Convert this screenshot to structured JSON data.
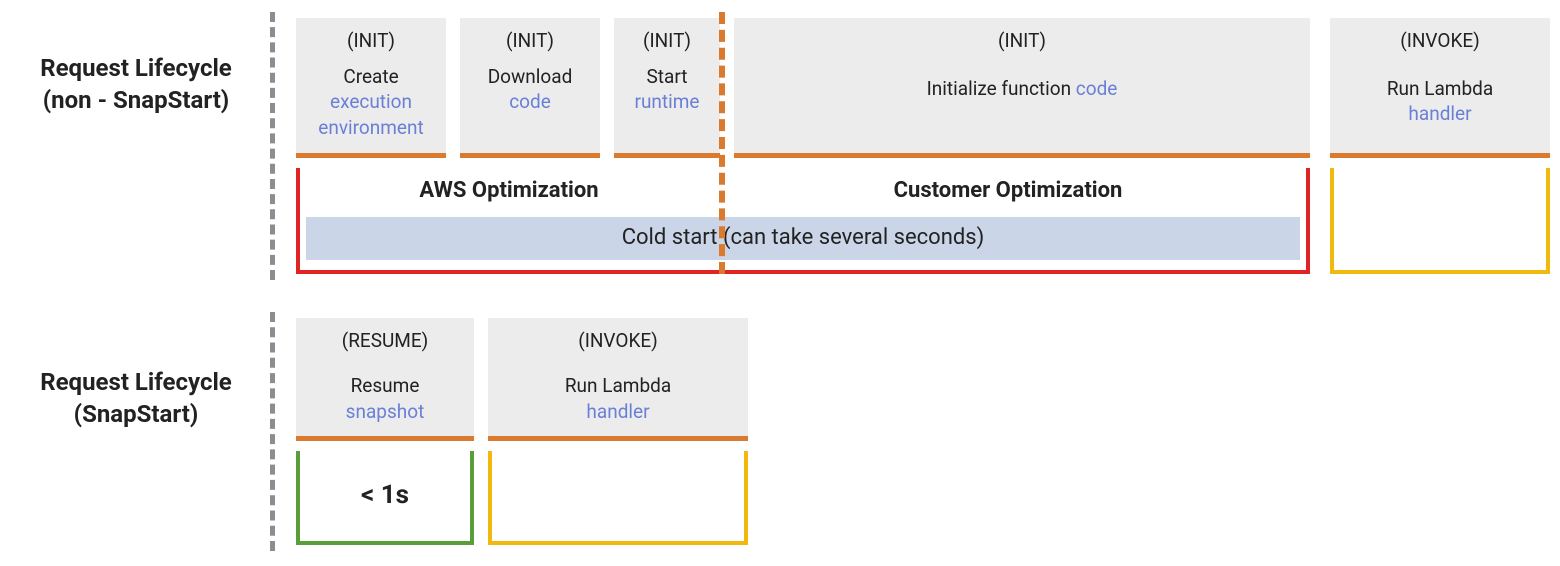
{
  "lifecycles": {
    "nonSnapStart": {
      "title_line1": "Request Lifecycle",
      "title_line2": "(non - SnapStart)",
      "phases": {
        "create": {
          "tag": "(INIT)",
          "line": "Create",
          "link_line1": "execution",
          "link_line2": "environment"
        },
        "download": {
          "tag": "(INIT)",
          "line": "Download",
          "link": "code"
        },
        "start": {
          "tag": "(INIT)",
          "line": "Start",
          "link": "runtime"
        },
        "initFn": {
          "tag": "(INIT)",
          "prefix": "Initialize function ",
          "link": "code"
        },
        "invoke": {
          "tag": "(INVOKE)",
          "line": "Run Lambda",
          "link": "handler"
        }
      },
      "optimization": {
        "aws": "AWS Optimization",
        "customer": "Customer Optimization"
      },
      "cold_start": "Cold start (can take several seconds)"
    },
    "snapStart": {
      "title_line1": "Request Lifecycle",
      "title_line2": "(SnapStart)",
      "phases": {
        "resume": {
          "tag": "(RESUME)",
          "line": "Resume",
          "link": "snapshot"
        },
        "invoke": {
          "tag": "(INVOKE)",
          "line": "Run Lambda",
          "link": "handler"
        }
      },
      "resume_time": "< 1s"
    }
  }
}
